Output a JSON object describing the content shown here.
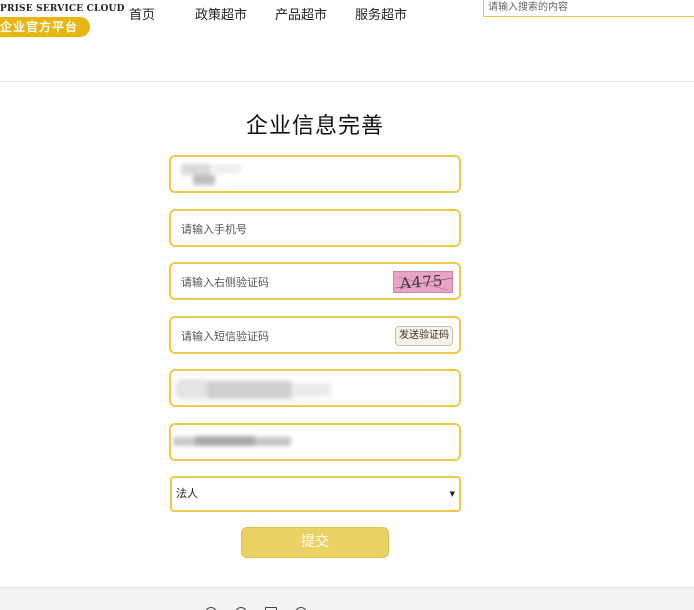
{
  "brand": {
    "subtitle": "PRISE SERVICE CLOUD",
    "name": "企业官方平台"
  },
  "nav": {
    "items": [
      "首页",
      "政策超市",
      "产品超市",
      "服务超市"
    ]
  },
  "search": {
    "placeholder": "请输入搜索的内容"
  },
  "form": {
    "title": "企业信息完善",
    "phone_placeholder": "请输入手机号",
    "captcha_placeholder": "请输入右侧验证码",
    "captcha_text": "A475",
    "sms_placeholder": "请输入短信验证码",
    "sms_button": "发送验证码",
    "role_selected": "法人",
    "submit_label": "提交"
  },
  "icons": {
    "select_arrow": "caret-down-icon",
    "footer": [
      "circle-icon",
      "circle-icon",
      "square-icon",
      "circle-icon"
    ]
  },
  "colors": {
    "accent": "#f0c94a",
    "brand_pill": "#e9b60f",
    "submit_bg": "#ebd064",
    "captcha_bg": "#e9a3c9"
  }
}
